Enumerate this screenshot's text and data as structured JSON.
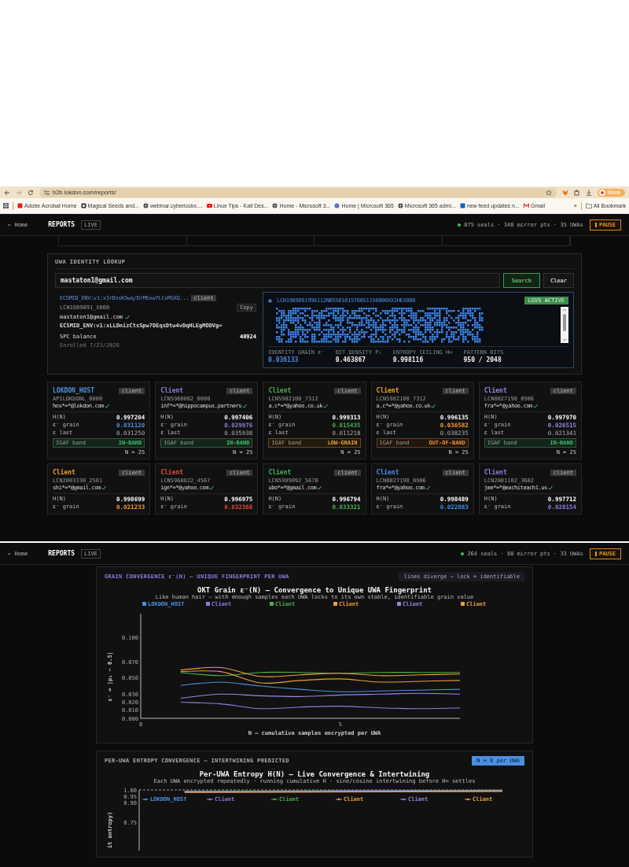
{
  "browser": {
    "url": "b2b.lokdon.com/reports/",
    "profile": "Work",
    "bookmarks": [
      {
        "label": "Adobe Acrobat Home",
        "kind": "pdf"
      },
      {
        "label": "Magical Seeds and...",
        "kind": "box"
      },
      {
        "label": "webinar.cyberlockx....",
        "kind": "globe"
      },
      {
        "label": "Linux Tips - Kali Des...",
        "kind": "video"
      },
      {
        "label": "Home - Microsoft 3...",
        "kind": "globe"
      },
      {
        "label": "Home | Microsoft 365",
        "kind": "flower"
      },
      {
        "label": "Microsoft 365 admi...",
        "kind": "globe"
      },
      {
        "label": "new feed updates n...",
        "kind": "in"
      },
      {
        "label": "Gmail",
        "kind": "mail"
      }
    ],
    "overflow": "»",
    "all_bookmarks": "All Bookmark"
  },
  "screens": [
    {
      "kind": "identity",
      "header": {
        "home": "← Home",
        "title": "REPORTS",
        "badge": "LIVE",
        "online": true,
        "stats": "875 seals · 348 mirror pts · 35 UWAs",
        "pause": "PAUSE"
      },
      "lookup": {
        "title": "UWA IDENTITY LOOKUP",
        "query": "mastaton1@gmail.com",
        "search": "Search",
        "clear": "Clear",
        "envelope": "ECSMID_ENV:v1:x3rDssK5wq/DrMSxw7LCvMSXQ...",
        "role": "client",
        "lcn": "LCN1989091_X800",
        "copy": "Copy",
        "email": "mastaton1@gmail.com",
        "verified": true,
        "envelope_2": "ECSMID_ENV:v1:xLLDnizCtsSpw7DEqsDtw4vDqHLEgMODVg=",
        "balance_label": "SPC balance",
        "balance": "40924",
        "enrolled": "Enrolled 7/23/2026",
        "pattern": {
          "id": "LCN1989091996112N0550101576051150000XX2HEX800",
          "status": "LGVS ACTIVE",
          "stats": [
            {
              "label": "IDENTITY GRAIN ε⁻",
              "value": "0.036133",
              "accent": true
            },
            {
              "label": "BIT DENSITY P₁",
              "value": "0.463867",
              "accent": false
            },
            {
              "label": "ENTROPY CEILING H∞",
              "value": "0.998116",
              "accent": false
            },
            {
              "label": "PATTERN BITS",
              "value": "950 / 2048",
              "accent": false
            }
          ]
        }
      },
      "cards": [
        {
          "name": "LOKDON_HOST",
          "color": "#4a90e2",
          "role": "client",
          "id": "APILOKDONL_0000",
          "email": "hos*=*@lokdon.com",
          "verified": true,
          "metrics": [
            {
              "label": "H(N)",
              "value": "0.997204",
              "kind": "entropy"
            },
            {
              "label": "ε⁻ grain",
              "value": "0.031120",
              "kind": "grain"
            },
            {
              "label": "ε last",
              "value": "0.031250",
              "kind": "last"
            }
          ],
          "band": {
            "label": "IGAF band",
            "status": "IN-BAND",
            "kind": "in"
          },
          "n": "N = 25"
        },
        {
          "name": "Client",
          "color": "#8a7ee0",
          "role": "client",
          "id": "LCN5960062_0000",
          "email": "inf*=*@hippocampus.partners",
          "verified": true,
          "metrics": [
            {
              "label": "H(N)",
              "value": "0.997406",
              "kind": "entropy"
            },
            {
              "label": "ε⁻ grain",
              "value": "0.029976",
              "kind": "grain"
            },
            {
              "label": "ε last",
              "value": "0.035938",
              "kind": "last"
            }
          ],
          "band": {
            "label": "IGAF band",
            "status": "IN-BAND",
            "kind": "in"
          },
          "n": "N = 25"
        },
        {
          "name": "Client",
          "color": "#4caf50",
          "role": "client",
          "id": "LCN5982100_7312",
          "email": "a.c*=*@yahoo.co.uk",
          "verified": true,
          "metrics": [
            {
              "label": "H(N)",
              "value": "0.999313",
              "kind": "entropy"
            },
            {
              "label": "ε⁻ grain",
              "value": "0.015435",
              "kind": "grain"
            },
            {
              "label": "ε last",
              "value": "0.011218",
              "kind": "last"
            }
          ],
          "band": {
            "label": "IGAF band",
            "status": "LOW-GRAIN",
            "kind": "low"
          },
          "n": "N = 25"
        },
        {
          "name": "Client",
          "color": "#f0a030",
          "role": "client",
          "id": "LCN5982100_7312",
          "email": "a.c*=*@yahoo.co.uk",
          "verified": true,
          "metrics": [
            {
              "label": "H(N)",
              "value": "0.996135",
              "kind": "entropy"
            },
            {
              "label": "ε⁻ grain",
              "value": "0.036582",
              "kind": "grain"
            },
            {
              "label": "ε last",
              "value": "0.038235",
              "kind": "last"
            }
          ],
          "band": {
            "label": "IGAF band",
            "status": "OUT-OF-BAND",
            "kind": "out"
          },
          "n": "N = 25"
        },
        {
          "name": "Client",
          "color": "#9486e6",
          "role": "client",
          "id": "LCN0027198_0906",
          "email": "fra*=*@yahoo.com",
          "verified": true,
          "metrics": [
            {
              "label": "H(N)",
              "value": "0.997970",
              "kind": "entropy"
            },
            {
              "label": "ε⁻ grain",
              "value": "0.026515",
              "kind": "grain"
            },
            {
              "label": "ε last",
              "value": "0.021341",
              "kind": "last"
            }
          ],
          "band": {
            "label": "IGAF band",
            "status": "IN-BAND",
            "kind": "in"
          },
          "n": "N = 25"
        },
        {
          "name": "Client",
          "color": "#f09a2a",
          "role": "client",
          "id": "LCN2003330_2501",
          "email": "shi*=*@gmail.com",
          "verified": true,
          "metrics": [
            {
              "label": "H(N)",
              "value": "0.998699",
              "kind": "entropy"
            },
            {
              "label": "ε⁻ grain",
              "value": "0.021233",
              "kind": "grain"
            }
          ]
        },
        {
          "name": "Client",
          "color": "#e0483e",
          "role": "client",
          "id": "LCN5960822_4567",
          "email": "ign*=*@yahoo.com",
          "verified": true,
          "metrics": [
            {
              "label": "H(N)",
              "value": "0.996975",
              "kind": "entropy"
            },
            {
              "label": "ε⁻ grain",
              "value": "0.032368",
              "kind": "grain"
            }
          ]
        },
        {
          "name": "Client",
          "color": "#45b058",
          "role": "client",
          "id": "LCN5989092_5670",
          "email": "ubo*=*@gmail.com",
          "verified": true,
          "metrics": [
            {
              "label": "H(N)",
              "value": "0.996794",
              "kind": "entropy"
            },
            {
              "label": "ε⁻ grain",
              "value": "0.033321",
              "kind": "grain"
            }
          ]
        },
        {
          "name": "Client",
          "color": "#3f8ee8",
          "role": "client",
          "id": "LCN0027198_0906",
          "email": "fra*=*@yahoo.com",
          "verified": true,
          "metrics": [
            {
              "label": "H(N)",
              "value": "0.998489",
              "kind": "entropy"
            },
            {
              "label": "ε⁻ grain",
              "value": "0.022883",
              "kind": "grain"
            }
          ]
        },
        {
          "name": "Client",
          "color": "#8c7fe4",
          "role": "client",
          "id": "LCN2001102_3602",
          "email": "jme*=*@eachiteach1.us",
          "verified": true,
          "metrics": [
            {
              "label": "H(N)",
              "value": "0.997712",
              "kind": "entropy"
            },
            {
              "label": "ε⁻ grain",
              "value": "0.028154",
              "kind": "grain"
            }
          ]
        }
      ]
    },
    {
      "kind": "charts",
      "header": {
        "home": "← Home",
        "title": "REPORTS",
        "badge": "LIVE",
        "online": true,
        "stats": "264 seals · 88 mirror pts · 33 UWAs",
        "pause": "PAUSE"
      },
      "charts": [
        {
          "kind": "grain",
          "heading": "GRAIN CONVERGENCE ε⁻(N) — UNIQUE FINGERPRINT PER UWA",
          "badge": "lines diverge → lock = identifiable",
          "subtitle": "Like human hair — with enough samples each UWA locks to its own stable, identifiable grain value",
          "chart_data": {
            "type": "line",
            "title": "OKT Grain ε⁻(N) — Convergence to Unique UWA Fingerprint",
            "xlabel": "N — cumulative samples encrypted per UWA",
            "ylabel": "ε⁻ = |p₁ − 0.5|",
            "x": [
              1,
              2,
              3,
              4,
              5,
              6,
              7,
              8
            ],
            "xlim": [
              0,
              8
            ],
            "ylim": [
              0,
              0.13
            ],
            "xticks": [
              0,
              5
            ],
            "yticks": [
              {
                "value": 0,
                "label": "0.000"
              },
              {
                "value": 0.01,
                "label": "0.010"
              },
              {
                "value": 0.02,
                "label": "0.020"
              },
              {
                "value": 0.03,
                "label": "0.030"
              },
              {
                "value": 0.05,
                "label": "0.050"
              },
              {
                "value": 0.07,
                "label": "0.070"
              },
              {
                "value": 0.1,
                "label": "0.100"
              }
            ],
            "series": [
              {
                "name": "LOKDON_HOST",
                "color": "#4a90e2",
                "values": [
                  0.041,
                  0.045,
                  0.04,
                  0.036,
                  0.033,
                  0.034,
                  0.035,
                  0.036
                ]
              },
              {
                "name": "Client",
                "color": "#8a7ee0",
                "values": [
                  0.02,
                  0.018,
                  0.012,
                  0.014,
                  0.015,
                  0.013,
                  0.012,
                  0.013
                ]
              },
              {
                "name": "Client",
                "color": "#4caf50",
                "values": [
                  0.057,
                  0.053,
                  0.057,
                  0.057,
                  0.056,
                  0.057,
                  0.057,
                  0.057
                ]
              },
              {
                "name": "Client",
                "color": "#f0a030",
                "values": [
                  0.06,
                  0.063,
                  0.052,
                  0.054,
                  0.056,
                  0.053,
                  0.054,
                  0.055
                ]
              },
              {
                "name": "Client",
                "color": "#9a86e6",
                "values": [
                  0.025,
                  0.03,
                  0.028,
                  0.027,
                  0.029,
                  0.03,
                  0.031,
                  0.03
                ]
              },
              {
                "name": "Client",
                "color": "#e8a040",
                "values": [
                  0.058,
                  0.058,
                  0.044,
                  0.047,
                  0.049,
                  0.045,
                  0.046,
                  0.047
                ]
              }
            ]
          }
        },
        {
          "kind": "entropy",
          "heading": "PER-UWA ENTROPY CONVERGENCE — INTERTWINING PREDICTED",
          "badge": "N = 8 per UWA",
          "title": "Per-UWA Entropy H(N) — Live Convergence & Intertwining",
          "subtitle": "Each UWA encrypted repeatedly · running cumulative H · sine/cosine intertwining before H∞ settles",
          "ylabel": "it entropy)",
          "yticks": [
            "1.00",
            "0.95",
            "0.90",
            "0.75"
          ],
          "legend": [
            {
              "name": "LOKDON_HOST",
              "color": "#4a90e2"
            },
            {
              "name": "Client",
              "color": "#8a7ee0"
            },
            {
              "name": "Client",
              "color": "#4caf50"
            },
            {
              "name": "Client",
              "color": "#f0a030"
            },
            {
              "name": "Client",
              "color": "#9a86e6"
            },
            {
              "name": "Client",
              "color": "#e8a040"
            }
          ]
        }
      ]
    }
  ]
}
